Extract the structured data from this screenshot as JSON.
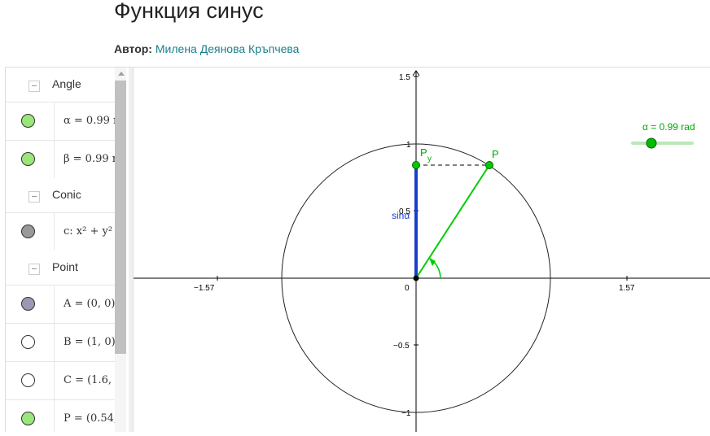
{
  "header": {
    "title": "Функция синус",
    "author_label": "Автор:",
    "author_name": "Милена Деянова Кръпчева"
  },
  "algebra": {
    "groups": [
      {
        "label": "Angle"
      },
      {
        "label": "Conic"
      },
      {
        "label": "Point"
      }
    ],
    "items": [
      {
        "text": "α = 0.99 r",
        "color": "#99e67a"
      },
      {
        "text": "β = 0.99 r",
        "color": "#99e67a"
      },
      {
        "text": "c: x² + y²",
        "color": "#999999"
      },
      {
        "text": "A = (0, 0)",
        "color": "#9999b3"
      },
      {
        "text": "B = (1, 0)",
        "color": "#ffffff"
      },
      {
        "text": "C = (1.6,",
        "color": "#ffffff"
      },
      {
        "text": "P = (0.54,",
        "color": "#99e67a"
      }
    ]
  },
  "graphics": {
    "x_ticks": [
      "−1.57",
      "0",
      "1.57"
    ],
    "y_ticks": [
      "1.5",
      "1",
      "0.5",
      "−0.5",
      "−1"
    ],
    "labels": {
      "point_p": "P",
      "point_py": "P",
      "point_py_sub": "y",
      "sin_label": "sinα"
    },
    "slider_label": "α = 0.99 rad",
    "slider_value": 0.99,
    "colors": {
      "sin_segment": "#1a3fcc",
      "radius": "#00cc00",
      "point": "#00aa00",
      "slider": "#00aa00"
    }
  }
}
